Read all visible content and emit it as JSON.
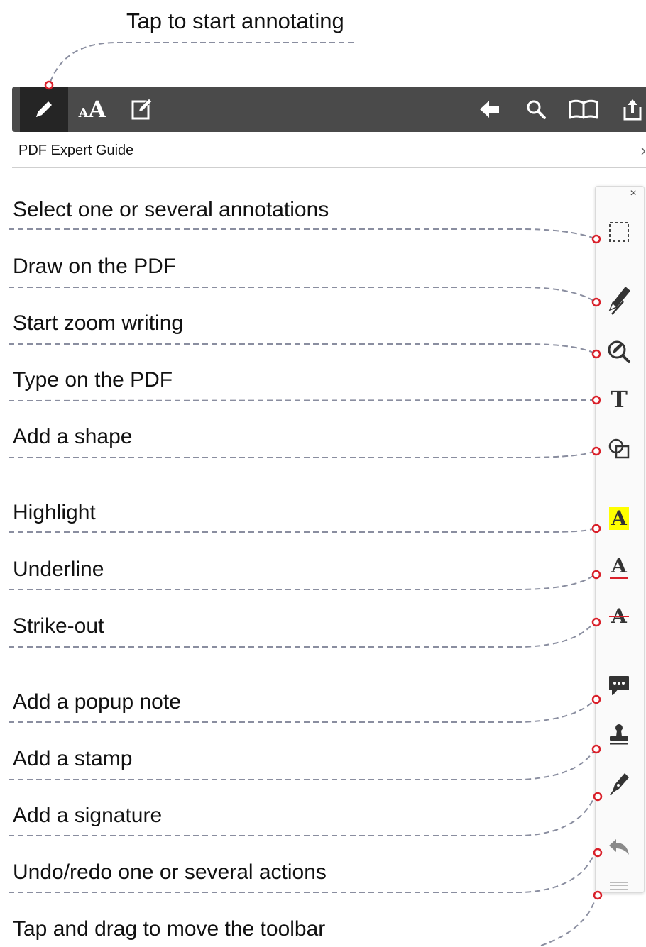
{
  "intro": {
    "label": "Tap to start annotating"
  },
  "toolbar": {
    "left_tools": [
      {
        "icon": "pencil-icon",
        "active": true
      },
      {
        "icon": "text-size-icon",
        "label": "AA"
      },
      {
        "icon": "edit-document-icon"
      }
    ],
    "right_tools": [
      {
        "icon": "back-arrow-icon"
      },
      {
        "icon": "search-icon"
      },
      {
        "icon": "book-icon"
      },
      {
        "icon": "share-icon"
      }
    ]
  },
  "document": {
    "title": "PDF Expert Guide",
    "chevron": "›"
  },
  "annotation_panel": {
    "close": "×",
    "tools": [
      {
        "icon": "select-rectangle-icon",
        "callout": "Select one or several annotations"
      },
      {
        "icon": "pen-draw-icon",
        "callout": "Draw on the PDF"
      },
      {
        "icon": "zoom-writing-icon",
        "callout": "Start zoom writing"
      },
      {
        "icon": "text-type-icon",
        "glyph": "T",
        "callout": "Type on the PDF"
      },
      {
        "icon": "shape-icon",
        "callout": "Add a shape"
      },
      {
        "icon": "highlight-icon",
        "glyph": "A",
        "callout": "Highlight"
      },
      {
        "icon": "underline-icon",
        "glyph": "A",
        "callout": "Underline"
      },
      {
        "icon": "strikeout-icon",
        "glyph": "A",
        "callout": "Strike-out"
      },
      {
        "icon": "popup-note-icon",
        "callout": "Add a popup note"
      },
      {
        "icon": "stamp-icon",
        "callout": "Add a stamp"
      },
      {
        "icon": "signature-pen-icon",
        "callout": "Add a signature"
      },
      {
        "icon": "undo-icon",
        "callout": "Undo/redo one or several actions"
      },
      {
        "icon": "drag-handle-icon",
        "callout": "Tap and drag to move the toolbar"
      }
    ]
  },
  "colors": {
    "toolbar_bg": "#4a4a4a",
    "active_bg": "#252525",
    "marker": "#d9202a",
    "dash": "#8a8ea0",
    "highlight": "#ffff00"
  }
}
